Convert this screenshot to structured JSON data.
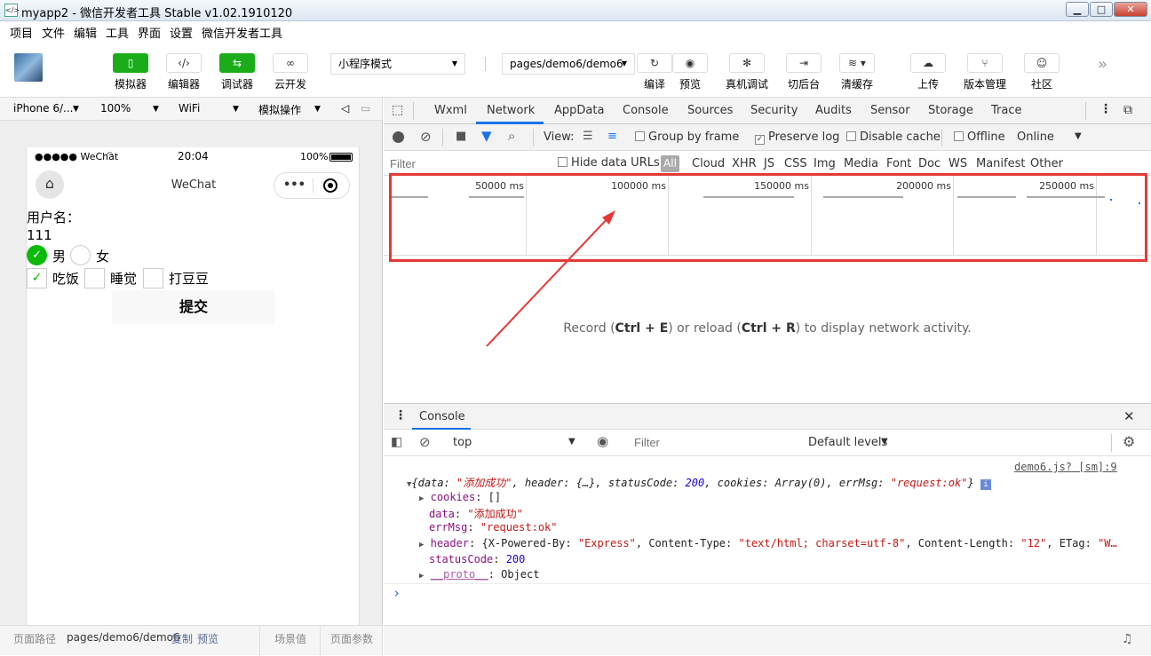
{
  "window": {
    "title": "myapp2 - 微信开发者工具 Stable v1.02.1910120",
    "min": "▁",
    "max": "□",
    "close": "✕"
  },
  "menu": [
    "项目",
    "文件",
    "编辑",
    "工具",
    "界面",
    "设置",
    "微信开发者工具"
  ],
  "toolbar": {
    "simulator": "模拟器",
    "editor": "编辑器",
    "debugger": "调试器",
    "cloud": "云开发",
    "mode": "小程序模式",
    "page": "pages/demo6/demo6",
    "compile": "编译",
    "preview": "预览",
    "realdebug": "真机调试",
    "background": "切后台",
    "cache": "清缓存",
    "upload": "上传",
    "version": "版本管理",
    "community": "社区"
  },
  "simbar": {
    "device": "iPhone 6/...",
    "zoom": "100%",
    "network": "WiFi",
    "simop": "模拟操作"
  },
  "phone": {
    "signal": "●●●●● WeChat",
    "time": "20:04",
    "battery": "100%",
    "nav_title": "WeChat",
    "username_label": "用户名：",
    "username_value": "111",
    "radio_male": "男",
    "radio_female": "女",
    "cb_eat": "吃饭",
    "cb_sleep": "睡觉",
    "cb_beans": "打豆豆",
    "submit": "提交"
  },
  "simfoot": {
    "path_label": "页面路径",
    "path": "pages/demo6/demo6",
    "copy": "复制",
    "preview": "预览",
    "scene": "场景值",
    "params": "页面参数"
  },
  "devtools": {
    "tabs": [
      "Wxml",
      "Network",
      "AppData",
      "Console",
      "Sources",
      "Security",
      "Audits",
      "Sensor",
      "Storage",
      "Trace"
    ],
    "active_tab": "Network",
    "view_label": "View:",
    "group_by_frame": "Group by frame",
    "preserve_log": "Preserve log",
    "disable_cache": "Disable cache",
    "offline": "Offline",
    "online": "Online",
    "filter_placeholder": "Filter",
    "hide_data_urls": "Hide data URLs",
    "types": [
      "All",
      "Cloud",
      "XHR",
      "JS",
      "CSS",
      "Img",
      "Media",
      "Font",
      "Doc",
      "WS",
      "Manifest",
      "Other"
    ],
    "ticks": [
      "50000 ms",
      "100000 ms",
      "150000 ms",
      "200000 ms",
      "250000 ms"
    ],
    "hint_pre": "Record (",
    "hint_k1": "Ctrl + E",
    "hint_mid": ") or reload (",
    "hint_k2": "Ctrl + R",
    "hint_post": ") to display network activity."
  },
  "console": {
    "title": "Console",
    "context": "top",
    "filter_placeholder": "Filter",
    "levels": "Default levels",
    "source": "demo6.js? [sm]:9",
    "summary_pre": "{data: ",
    "summary_data": "\"添加成功\"",
    "summary_mid1": ", header: {…}, statusCode: ",
    "summary_status": "200",
    "summary_mid2": ", cookies: Array(0), errMsg: ",
    "summary_err": "\"request:ok\"",
    "summary_end": "}",
    "cookies_k": "cookies",
    "cookies_v": ": []",
    "data_k": "data",
    "data_v": "\"添加成功\"",
    "errmsg_k": "errMsg",
    "errmsg_v": "\"request:ok\"",
    "header_k": "header",
    "header_v1": ": {X-Powered-By: ",
    "header_s1": "\"Express\"",
    "header_v2": ", Content-Type: ",
    "header_s2": "\"text/html; charset=utf-8\"",
    "header_v3": ", Content-Length: ",
    "header_s3": "\"12\"",
    "header_v4": ", ETag: ",
    "header_s4": "\"W…",
    "status_k": "statusCode",
    "status_v": "200",
    "proto_k": "__proto__",
    "proto_v": ": Object",
    "prompt": "›"
  }
}
